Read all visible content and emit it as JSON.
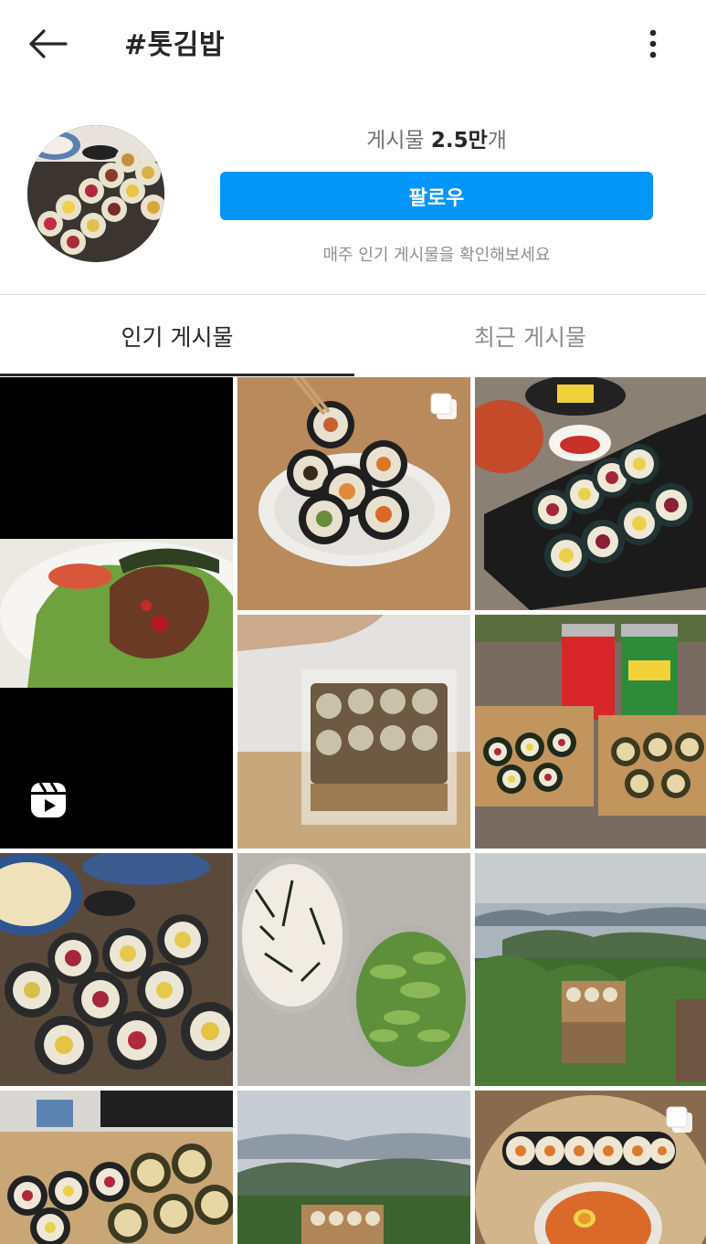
{
  "header": {
    "title": "#톳김밥",
    "back_icon": "arrow-left-icon",
    "more_icon": "more-vertical-icon"
  },
  "profile": {
    "posts_label": "게시물",
    "posts_count": "2.5만",
    "posts_unit": "개",
    "follow_label": "팔로우",
    "weekly_note": "매주 인기 게시물을 확인해보세요"
  },
  "tabs": [
    {
      "label": "인기 게시물",
      "active": true
    },
    {
      "label": "최근 게시물",
      "active": false
    }
  ],
  "grid": {
    "posts": [
      {
        "type": "reel",
        "icon": "reels-icon",
        "alt": "salad bowl"
      },
      {
        "type": "carousel",
        "icon": "carousel-icon",
        "alt": "kimbap plate"
      },
      {
        "type": "photo",
        "alt": "kimbap platter"
      },
      {
        "type": "photo",
        "alt": "kimbap in plastic box"
      },
      {
        "type": "photo",
        "alt": "kimbap with cans"
      },
      {
        "type": "photo",
        "alt": "kimbap with noodles"
      },
      {
        "type": "photo",
        "alt": "side dishes"
      },
      {
        "type": "photo",
        "alt": "island landscape"
      },
      {
        "type": "photo",
        "alt": "kimbap rows"
      },
      {
        "type": "photo",
        "alt": "mountain kimbap"
      },
      {
        "type": "carousel",
        "icon": "carousel-icon",
        "alt": "kimbap and noodles"
      }
    ]
  },
  "colors": {
    "accent": "#0095f6",
    "text": "#262626",
    "muted": "#8e8e8e"
  }
}
